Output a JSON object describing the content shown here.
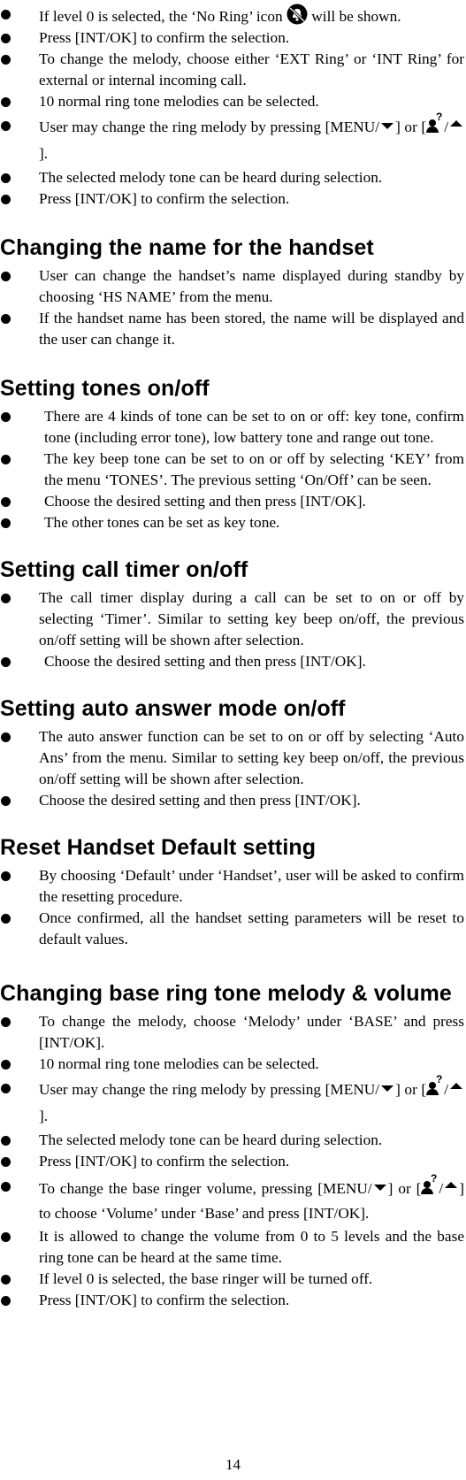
{
  "page_number": "14",
  "intro_items": [
    {
      "pre": "If level 0 is selected, the ‘No Ring’ icon",
      "post": "will be shown."
    },
    {
      "text": "Press [INT/OK] to confirm the selection."
    },
    {
      "text": "To change the melody, choose either ‘EXT Ring’ or ‘INT Ring’ for external or internal incoming call."
    },
    {
      "text": "10 normal ring tone melodies can be selected."
    },
    {
      "line1": "User may change the ring melody by pressing",
      "menu": "[MENU/",
      "close1": "] or",
      "open2": "[",
      "slash": "/",
      "close2": "]."
    },
    {
      "text": "The selected melody tone can be heard during selection."
    },
    {
      "text": "Press [INT/OK] to confirm the selection."
    }
  ],
  "sections": [
    {
      "title": "Changing the name for the handset",
      "items": [
        "User can change the handset’s name displayed during standby by choosing ‘HS NAME’ from the menu.",
        "If the handset name has been stored, the name will be displayed and the user can change it."
      ]
    },
    {
      "title": "Setting tones on/off",
      "items": [
        "There are 4 kinds of tone can be set to on or off: key tone, confirm tone (including error tone), low battery tone and range out tone.",
        "The key beep tone can be set to on or off by selecting ‘KEY’ from the menu ‘TONES’. The previous setting ‘On/Off’ can be seen.",
        "Choose the desired setting and then press [INT/OK].",
        "The other tones can be set as key tone."
      ]
    },
    {
      "title": "Setting call timer on/off",
      "items": [
        "The call timer display during a call can be set to on or off by selecting ‘Timer’. Similar to setting key beep on/off, the previous on/off setting will be shown after selection.",
        "Choose the desired setting and then press [INT/OK]."
      ]
    },
    {
      "title": "Setting auto answer mode on/off",
      "items": [
        "The auto answer function can be set to on or off by selecting ‘Auto Ans’ from the menu. Similar to setting key beep on/off, the previous on/off setting will be shown after selection.",
        "Choose the desired setting and then press [INT/OK]."
      ]
    },
    {
      "title": "Reset Handset Default setting",
      "items": [
        "By choosing ‘Default’ under ‘Handset’, user will be asked to confirm the resetting procedure.",
        "Once confirmed, all the handset setting parameters will be reset to default values."
      ]
    },
    {
      "title": "Changing base ring tone melody & volume",
      "items": [
        {
          "text": "To change the melody, choose ‘Melody’ under ‘BASE’ and press [INT/OK]."
        },
        {
          "text": "10 normal ring tone melodies can be selected."
        },
        {
          "line1": "User may change the ring melody by pressing",
          "menu": "[MENU/",
          "close1": "] or",
          "open2": "[",
          "slash": "/",
          "close2": "]."
        },
        {
          "text": "The selected melody tone can be heard during selection."
        },
        {
          "text": "Press [INT/OK] to confirm the selection."
        },
        {
          "pre": "To change the base ringer volume, pressing [MENU/",
          "mid1": "]",
          "mid2": "or [",
          "slash": "/",
          "post": "] to choose ‘Volume’ under ‘Base’ and press [INT/OK]."
        },
        {
          "text": "It is allowed to change the volume from 0 to 5 levels and the base ring tone can be heard at the same time."
        },
        {
          "text": "If level 0 is selected, the base ringer will be turned off."
        },
        {
          "text": "Press [INT/OK] to confirm the selection."
        }
      ]
    }
  ],
  "icons": {
    "no_ring": "no-ring-bell-icon",
    "menu_down": "down-triangle-icon",
    "phonebook": "person-question-icon",
    "up": "up-triangle-icon"
  }
}
